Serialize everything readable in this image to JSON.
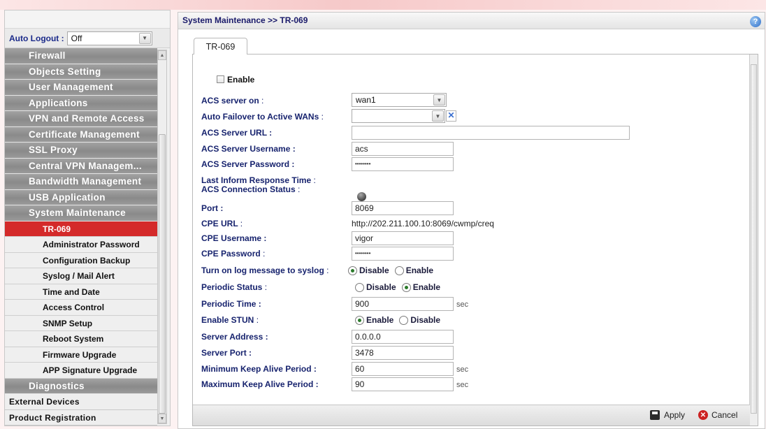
{
  "breadcrumb": "System Maintenance >> TR-069",
  "auto_logout": {
    "label": "Auto Logout :",
    "value": "Off"
  },
  "sidebar": {
    "menu": [
      {
        "label": "Firewall",
        "name": "firewall"
      },
      {
        "label": "Objects Setting",
        "name": "objects-setting"
      },
      {
        "label": "User Management",
        "name": "user-management"
      },
      {
        "label": "Applications",
        "name": "applications"
      },
      {
        "label": "VPN and Remote Access",
        "name": "vpn-remote-access"
      },
      {
        "label": "Certificate Management",
        "name": "certificate-management"
      },
      {
        "label": "SSL Proxy",
        "name": "ssl-proxy"
      },
      {
        "label": "Central VPN Managem...",
        "name": "central-vpn-management"
      },
      {
        "label": "Bandwidth Management",
        "name": "bandwidth-management"
      },
      {
        "label": "USB Application",
        "name": "usb-application"
      },
      {
        "label": "System Maintenance",
        "name": "system-maintenance"
      }
    ],
    "submenu": [
      {
        "label": "TR-069",
        "name": "tr-069",
        "active": true
      },
      {
        "label": "Administrator Password",
        "name": "administrator-password"
      },
      {
        "label": "Configuration Backup",
        "name": "configuration-backup"
      },
      {
        "label": "Syslog / Mail Alert",
        "name": "syslog-mail-alert"
      },
      {
        "label": "Time and Date",
        "name": "time-and-date"
      },
      {
        "label": "Access Control",
        "name": "access-control"
      },
      {
        "label": "SNMP Setup",
        "name": "snmp-setup"
      },
      {
        "label": "Reboot System",
        "name": "reboot-system"
      },
      {
        "label": "Firmware Upgrade",
        "name": "firmware-upgrade"
      },
      {
        "label": "APP Signature Upgrade",
        "name": "app-signature-upgrade"
      }
    ],
    "after": [
      {
        "label": "Diagnostics",
        "name": "diagnostics",
        "style": "dark"
      },
      {
        "label": "External Devices",
        "name": "external-devices",
        "style": "light"
      },
      {
        "label": "Product Registration",
        "name": "product-registration",
        "style": "light"
      }
    ]
  },
  "tab": "TR-069",
  "form": {
    "enable_label": "Enable",
    "acs_server_on_label": "ACS server on",
    "acs_server_on_value": "wan1",
    "auto_failover_label": "Auto Failover to Active WANs",
    "auto_failover_value": "",
    "acs_url_label": "ACS Server URL :",
    "acs_url_value": "",
    "acs_username_label": "ACS Server Username :",
    "acs_username_value": "acs",
    "acs_password_label": "ACS Server Password :",
    "acs_password_value": "••••••••",
    "last_inform_label": "Last Inform Response Time",
    "acs_conn_status_label": "ACS Connection Status",
    "port_label": "Port :",
    "port_value": "8069",
    "cpe_url_label": "CPE URL",
    "cpe_url_value": "http://202.211.100.10:8069/cwmp/creq",
    "cpe_username_label": "CPE Username :",
    "cpe_username_value": "vigor",
    "cpe_password_label": "CPE Password",
    "cpe_password_value": "••••••••",
    "log_syslog_label": "Turn on log message to syslog",
    "periodic_status_label": "Periodic Status",
    "periodic_time_label": "Periodic Time :",
    "periodic_time_value": "900",
    "enable_stun_label": "Enable STUN",
    "server_address_label": "Server Address :",
    "server_address_value": "0.0.0.0",
    "server_port_label": "Server Port :",
    "server_port_value": "3478",
    "min_keepalive_label": "Minimum Keep Alive Period :",
    "min_keepalive_value": "60",
    "max_keepalive_label": "Maximum Keep Alive Period :",
    "max_keepalive_value": "90",
    "sec": "sec",
    "colon": ":",
    "disable": "Disable",
    "enable": "Enable"
  },
  "footer": {
    "apply": "Apply",
    "cancel": "Cancel"
  },
  "icons": {
    "help": "help-icon",
    "save": "save-icon",
    "cancel": "cancel-icon",
    "status": "status-ball-icon"
  }
}
